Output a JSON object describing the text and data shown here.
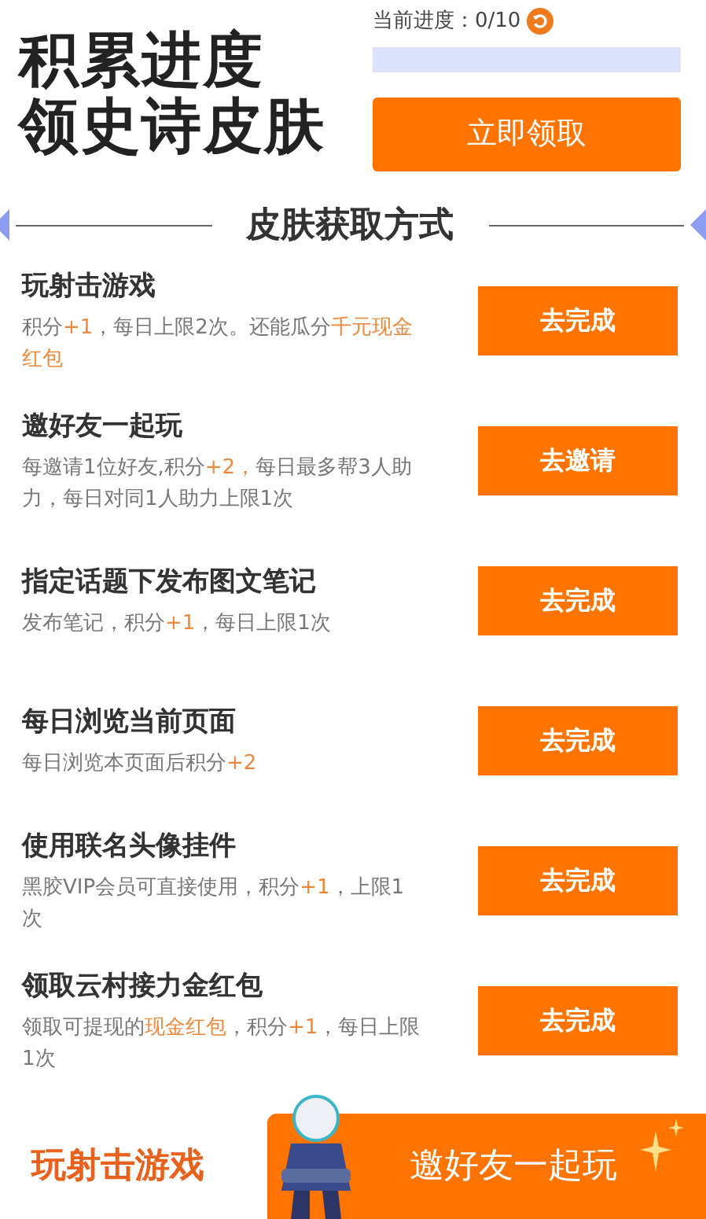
{
  "header": {
    "title_lines": [
      "积累进度",
      "领史诗皮肤"
    ],
    "progress_label": "当前进度：0/10",
    "progress": {
      "level": 0
    },
    "claim_button": "立即领取"
  },
  "section_title": "皮肤获取方式",
  "tasks": [
    {
      "title": "玩射击游戏",
      "description": [
        {
          "text": "积分"
        },
        {
          "text": "+1",
          "highlight": true
        },
        {
          "text": "，每日上限2次。还能瓜分"
        },
        {
          "text": "千元现金红包",
          "highlight": true
        }
      ],
      "button": "去完成"
    },
    {
      "title": "邀好友一起玩",
      "description": [
        {
          "text": "每邀请1位好友,积分"
        },
        {
          "text": "+2，",
          "highlight": true
        },
        {
          "text": "每日最多帮3人助力，每日对同1人助力上限1次"
        }
      ],
      "button": "去邀请"
    },
    {
      "title": "指定话题下发布图文笔记",
      "description": [
        {
          "text": "发布笔记，积分"
        },
        {
          "text": "+1",
          "highlight": true
        },
        {
          "text": "，每日上限1次"
        }
      ],
      "button": "去完成"
    },
    {
      "title": "每日浏览当前页面",
      "description": [
        {
          "text": "每日浏览本页面后积分"
        },
        {
          "text": "+2",
          "highlight": true
        }
      ],
      "button": "去完成"
    },
    {
      "title": "使用联名头像挂件",
      "description": [
        {
          "text": "黑胶VIP会员可直接使用，积分"
        },
        {
          "text": "+1",
          "highlight": true
        },
        {
          "text": "，上限1次"
        }
      ],
      "button": "去完成"
    },
    {
      "title": "领取云村接力金红包",
      "description": [
        {
          "text": "领取可提现的"
        },
        {
          "text": "现金红包",
          "highlight": true
        },
        {
          "text": "，积分"
        },
        {
          "text": "+1",
          "highlight": true
        },
        {
          "text": "，每日上限1次"
        }
      ],
      "button": "去完成"
    }
  ],
  "bottom_tabs": [
    {
      "label": "玩射击游戏",
      "kind": "light"
    },
    {
      "label": "邀好友一起玩",
      "kind": "accent"
    }
  ]
}
